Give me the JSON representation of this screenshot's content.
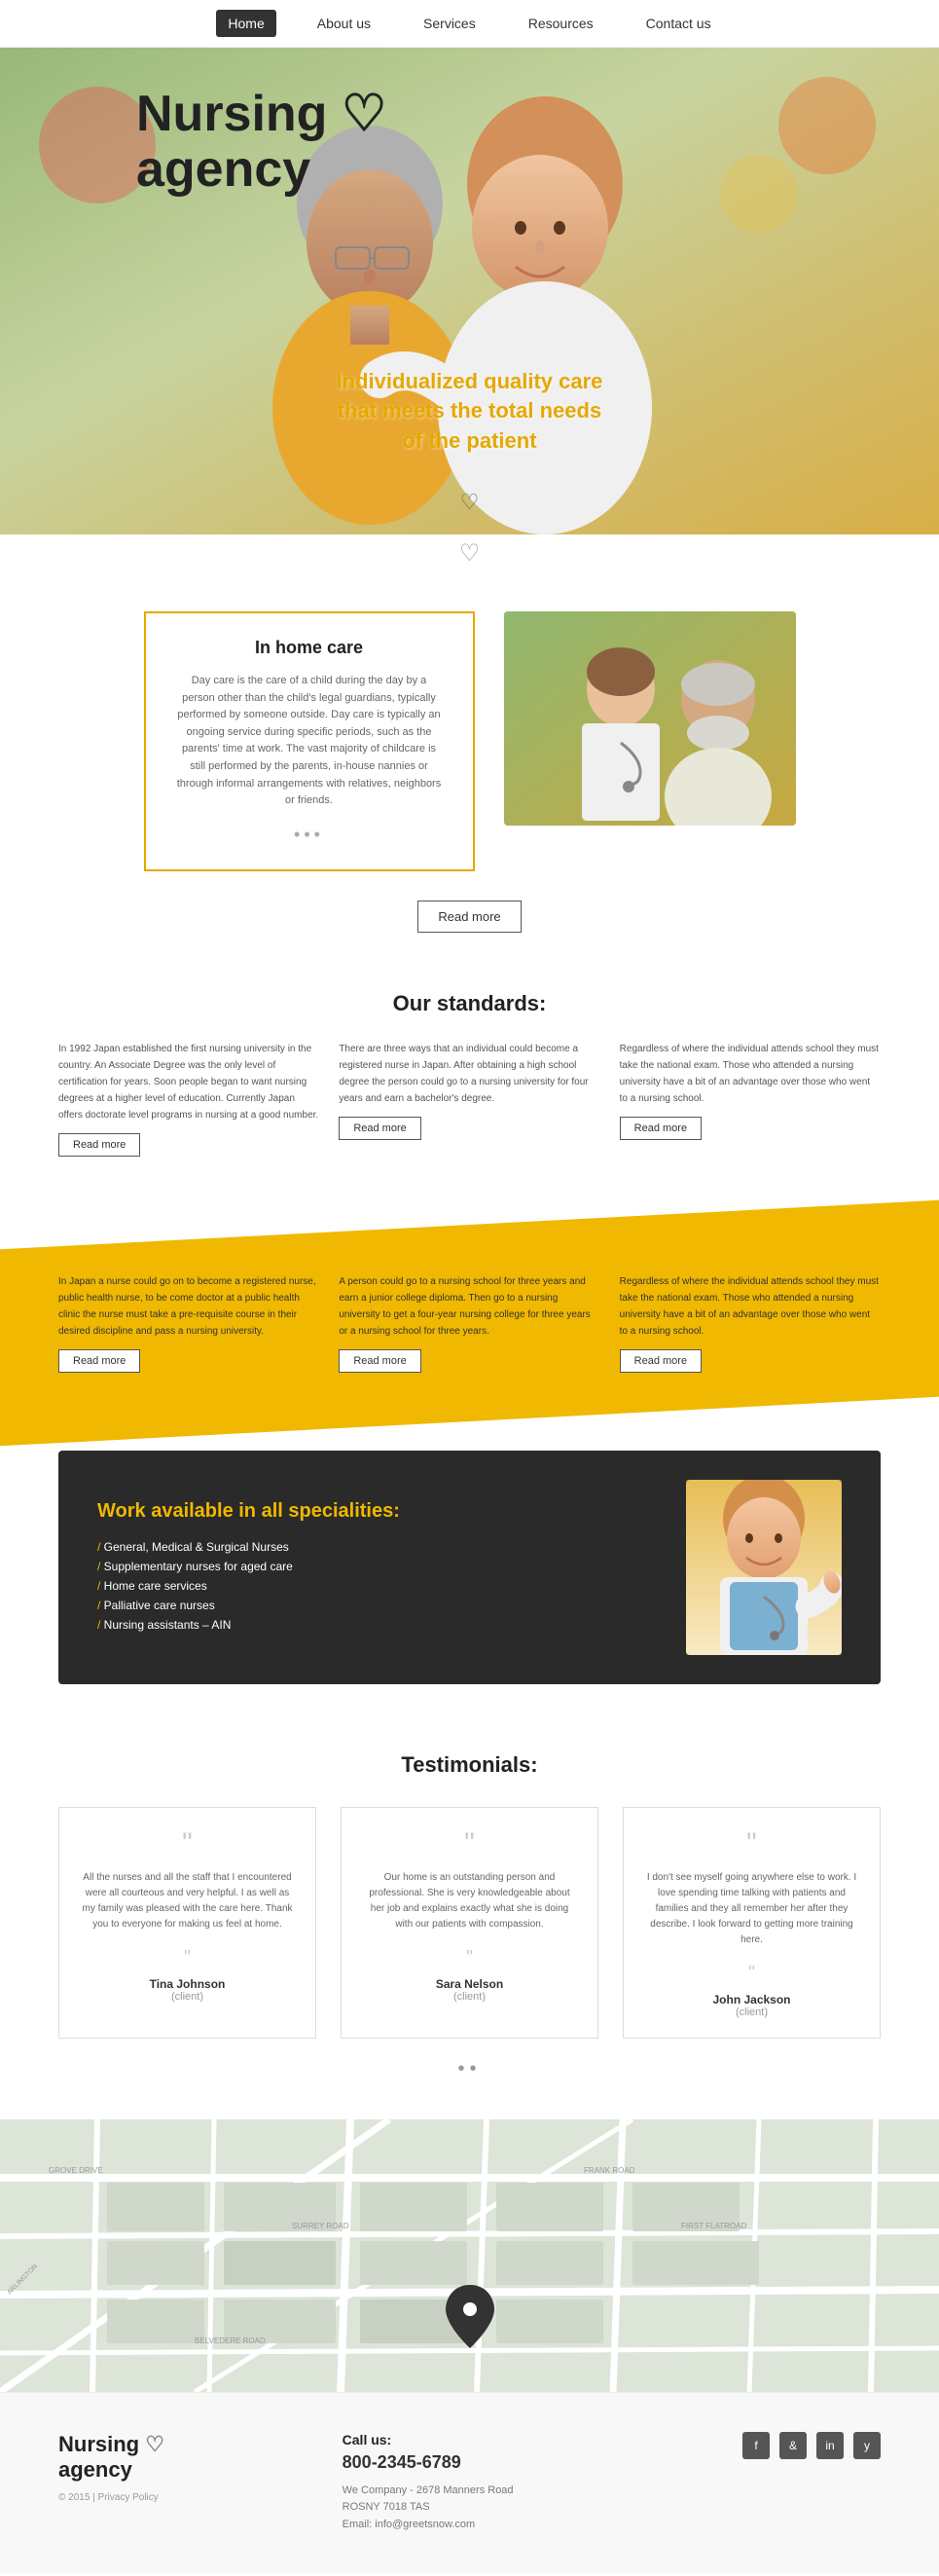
{
  "nav": {
    "items": [
      {
        "label": "Home",
        "active": true
      },
      {
        "label": "About us",
        "active": false
      },
      {
        "label": "Services",
        "active": false
      },
      {
        "label": "Resources",
        "active": false
      },
      {
        "label": "Contact us",
        "active": false
      }
    ]
  },
  "hero": {
    "title_line1": "Nursing",
    "title_line2": "agency",
    "heart_symbol": "♡",
    "subtitle": "Individualized quality care\nthat meets the total needs\nof the patient"
  },
  "care": {
    "section_heart": "♡",
    "card_title": "In home care",
    "card_text": "Day care is the care of a child during the day by a person other than the child's legal guardians, typically performed by someone outside. Day care is typically an ongoing service during specific periods, such as the parents' time at work. The vast majority of childcare is still performed by the parents, in-house nannies or through informal arrangements with relatives, neighbors or friends.",
    "dots": "•••",
    "read_more": "Read more"
  },
  "standards": {
    "title": "Our standards:",
    "items": [
      {
        "text": "In 1992 Japan established the first nursing university in the country. An Associate Degree was the only level of certification for years. Soon people began to want nursing degrees at a higher level of education. Currently Japan offers doctorate level programs in nursing at a good number.",
        "btn": "Read more"
      },
      {
        "text": "There are three ways that an individual could become a registered nurse in Japan. After obtaining a high school degree the person could go to a nursing university for four years and earn a bachelor's degree.",
        "btn": "Read more"
      },
      {
        "text": "Regardless of where the individual attends school they must take the national exam. Those who attended a nursing university have a bit of an advantage over those who went to a nursing school.",
        "btn": "Read more"
      },
      {
        "text": "In Japan a nurse could go on to become a registered nurse, public health nurse, to be come doctor at a public health clinic the nurse must take a pre-requisite course in their desired discipline and pass a nursing university.",
        "btn": "Read more"
      },
      {
        "text": "A person could go to a nursing school for three years and earn a junior college diploma. Then go to a nursing university to get a four-year nursing college for three years or a nursing school for three years.",
        "btn": "Read more"
      },
      {
        "text": "Regardless of where the individual attends school they must take the national exam. Those who attended a nursing university have a bit of an advantage over those who went to a nursing school.",
        "btn": "Read more"
      }
    ]
  },
  "specialities": {
    "title": "Work available in all specialities:",
    "items": [
      "General, Medical & Surgical Nurses",
      "Supplementary nurses for aged care",
      "Home care services",
      "Palliative care nurses",
      "Nursing assistants – AIN"
    ]
  },
  "testimonials": {
    "title": "Testimonials:",
    "items": [
      {
        "text": "All the nurses and all the staff that I encountered were all courteous and very helpful. I as well as my family was pleased with the care here. Thank you to everyone for making us feel at home.",
        "name": "Tina Johnson",
        "role": "(client)"
      },
      {
        "text": "Our home is an outstanding person and professional. She is very knowledgeable about her job and explains exactly what she is doing with our patients with compassion.",
        "name": "Sara Nelson",
        "role": "(client)"
      },
      {
        "text": "I don't see myself going anywhere else to work. I love spending time talking with patients and families and they all remember her after they describe. I look forward to getting more training here.",
        "name": "John Jackson",
        "role": "(client)"
      }
    ],
    "nav_dots": "••"
  },
  "footer": {
    "brand": "Nursing",
    "brand_sub": "agency",
    "heart": "♡",
    "copyright": "© 2015 | Privacy Policy",
    "call_label": "Call us:",
    "phone": "800-2345-6789",
    "address_line1": "We Company - 2678 Manners Road",
    "address_line2": "ROSNY 7018 TAS",
    "email": "Email: info@greetsnow.com",
    "social": [
      "f",
      "&",
      "in",
      "y"
    ]
  }
}
